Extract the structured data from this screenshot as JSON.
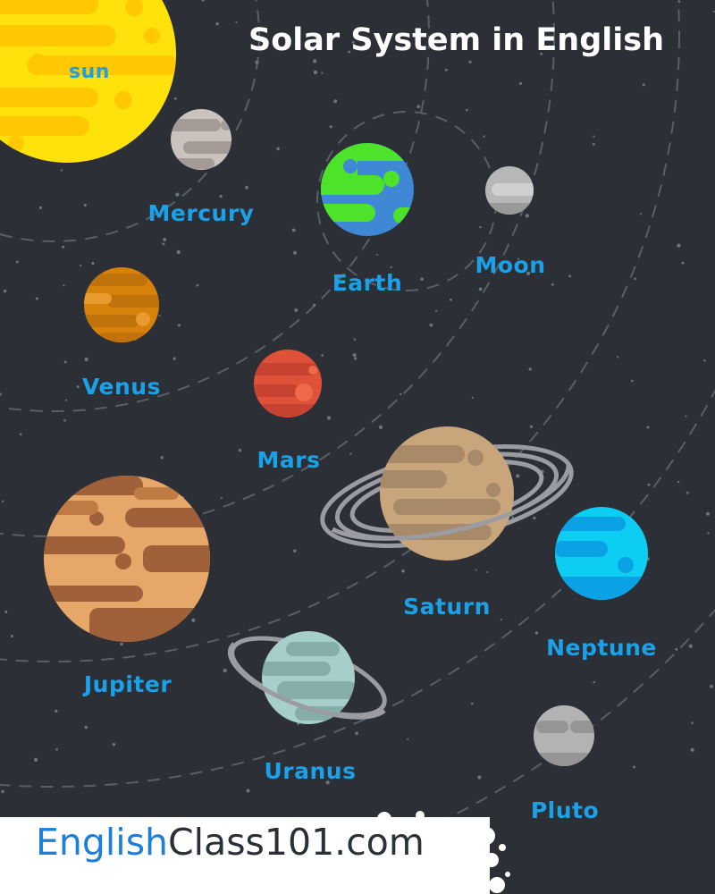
{
  "title": "Solar System in English",
  "labels": {
    "sun": "sun",
    "mercury": "Mercury",
    "earth": "Earth",
    "moon": "Moon",
    "venus": "Venus",
    "mars": "Mars",
    "saturn": "Saturn",
    "neptune": "Neptune",
    "jupiter": "Jupiter",
    "uranus": "Uranus",
    "pluto": "Pluto"
  },
  "brand": {
    "part1": "English",
    "part2": "Class101.com"
  },
  "colors": {
    "background": "#2c2f36",
    "label": "#1aa1e8",
    "sun": "#ffe20c",
    "mercury": "#c9c2bd",
    "earth_land": "#4ee32b",
    "earth_water": "#3e88d5",
    "moon": "#b7b7b7",
    "venus": "#d6810a",
    "mars": "#e0513a",
    "saturn": "#c9a57c",
    "neptune": "#0ecdf2",
    "jupiter": "#e7a769",
    "uranus": "#a6cfcb",
    "pluto": "#b3b3b3",
    "brand_english": "#1c80d8",
    "brand_class": "#2b2f38"
  }
}
